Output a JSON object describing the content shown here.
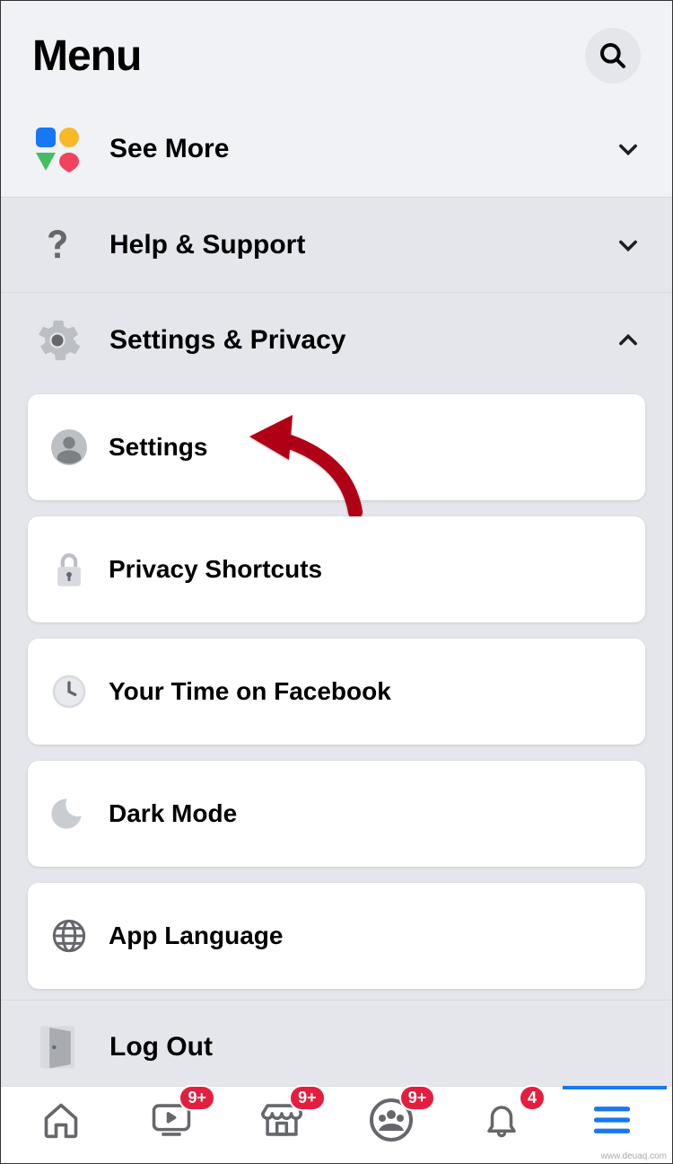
{
  "header": {
    "title": "Menu"
  },
  "sections": {
    "see_more": {
      "label": "See More"
    },
    "help": {
      "label": "Help & Support"
    },
    "settings_privacy": {
      "label": "Settings & Privacy"
    }
  },
  "settings_items": {
    "settings": "Settings",
    "privacy_shortcuts": "Privacy Shortcuts",
    "your_time": "Your Time on Facebook",
    "dark_mode": "Dark Mode",
    "app_language": "App Language"
  },
  "logout": {
    "label": "Log Out"
  },
  "tabbar": {
    "watch_badge": "9+",
    "marketplace_badge": "9+",
    "groups_badge": "9+",
    "notifications_badge": "4"
  },
  "watermark": "www.deuaq.com"
}
